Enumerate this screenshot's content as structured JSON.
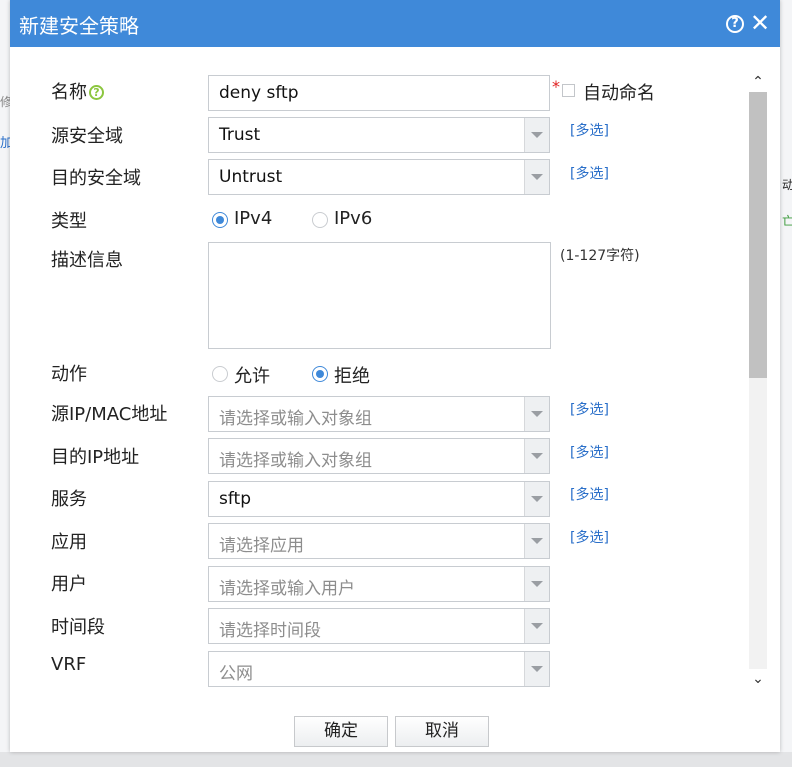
{
  "dialog": {
    "title": "新建安全策略"
  },
  "background": {
    "frag1": "修",
    "frag2": "加",
    "frag3": "动",
    "frag4": "亡"
  },
  "form": {
    "name": {
      "label": "名称",
      "value": "deny sftp",
      "auto_name_label": "自动命名",
      "auto_name_checked": false
    },
    "src_zone": {
      "label": "源安全域",
      "value": "Trust",
      "multi": "[多选]"
    },
    "dst_zone": {
      "label": "目的安全域",
      "value": "Untrust",
      "multi": "[多选]"
    },
    "type": {
      "label": "类型",
      "options": [
        "IPv4",
        "IPv6"
      ],
      "selected": "IPv4"
    },
    "description": {
      "label": "描述信息",
      "value": "",
      "hint": "(1-127字符)"
    },
    "action": {
      "label": "动作",
      "options": [
        "允许",
        "拒绝"
      ],
      "selected": "拒绝"
    },
    "src_ip": {
      "label": "源IP/MAC地址",
      "placeholder": "请选择或输入对象组",
      "multi": "[多选]"
    },
    "dst_ip": {
      "label": "目的IP地址",
      "placeholder": "请选择或输入对象组",
      "multi": "[多选]"
    },
    "service": {
      "label": "服务",
      "value": "sftp",
      "multi": "[多选]"
    },
    "application": {
      "label": "应用",
      "placeholder": "请选择应用",
      "multi": "[多选]"
    },
    "user": {
      "label": "用户",
      "placeholder": "请选择或输入用户"
    },
    "time_range": {
      "label": "时间段",
      "placeholder": "请选择时间段"
    },
    "vrf": {
      "label": "VRF",
      "value": "公网"
    }
  },
  "buttons": {
    "ok": "确定",
    "cancel": "取消"
  },
  "colors": {
    "titlebar": "#3f89d9",
    "link": "#2a6fc9",
    "required": "#e02020",
    "help_green": "#8cc63f"
  }
}
